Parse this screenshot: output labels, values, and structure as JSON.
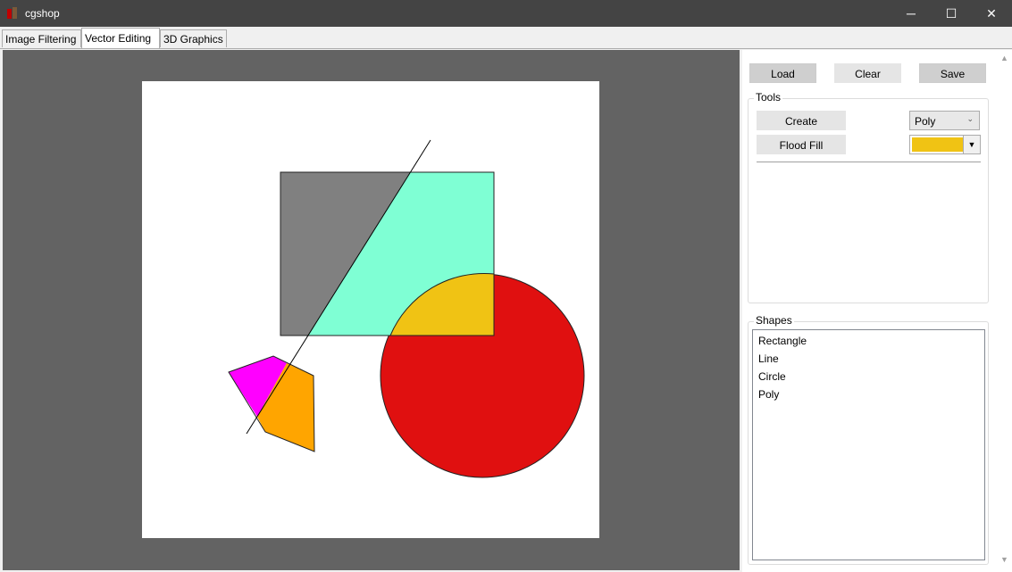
{
  "window": {
    "title": "cgshop",
    "min_glyph": "─",
    "max_glyph": "☐",
    "close_glyph": "✕"
  },
  "tabs": [
    {
      "label": "Image Filtering",
      "active": false
    },
    {
      "label": "Vector Editing",
      "active": true
    },
    {
      "label": "3D Graphics",
      "active": false
    }
  ],
  "toolbar": {
    "load_label": "Load",
    "clear_label": "Clear",
    "save_label": "Save"
  },
  "tools": {
    "group_label": "Tools",
    "create_label": "Create",
    "flood_fill_label": "Flood Fill",
    "shape_type": "Poly",
    "fill_color": "#f0c314"
  },
  "shapes": {
    "group_label": "Shapes",
    "items": [
      "Rectangle",
      "Line",
      "Circle",
      "Poly"
    ]
  },
  "colors": {
    "canvas_bg": "#ffffff",
    "workspace_bg": "#636363",
    "rect_left": "#808080",
    "rect_right": "#7fffd4",
    "circle": "#e01010",
    "overlap": "#f0c314",
    "poly_left": "#ff00ff",
    "poly_right": "#ffa500"
  }
}
